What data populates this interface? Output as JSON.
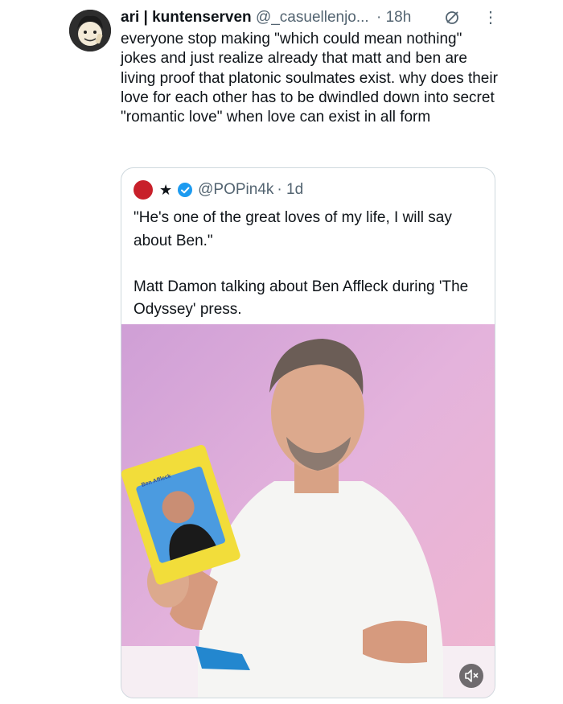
{
  "tweet": {
    "name": "ari | kuntenserven",
    "handle": "@_casuellenjo...",
    "time": "· 18h",
    "text": "everyone stop making \"which could mean nothing\" jokes and just realize already that matt and ben are living proof that platonic soulmates exist. why does their love for each other has to be dwindled down into secret \"romantic love\" when love can exist in all form"
  },
  "quote": {
    "star": "★",
    "handle": "@POPin4k",
    "time": "· 1d",
    "text": "\"He's one of the great loves of my life, I will say about Ben.\"\n\nMatt Damon talking about Ben Affleck during 'The Odyssey' press.",
    "card_label": "Ben Affleck"
  },
  "icons": {
    "grok": "grok-icon",
    "more": "more-icon",
    "verified": "verified-icon",
    "mute": "volume-mute-icon"
  },
  "colors": {
    "text": "#0f1419",
    "muted": "#536471",
    "verified": "#1d9bf0",
    "border": "#cfd9de"
  }
}
